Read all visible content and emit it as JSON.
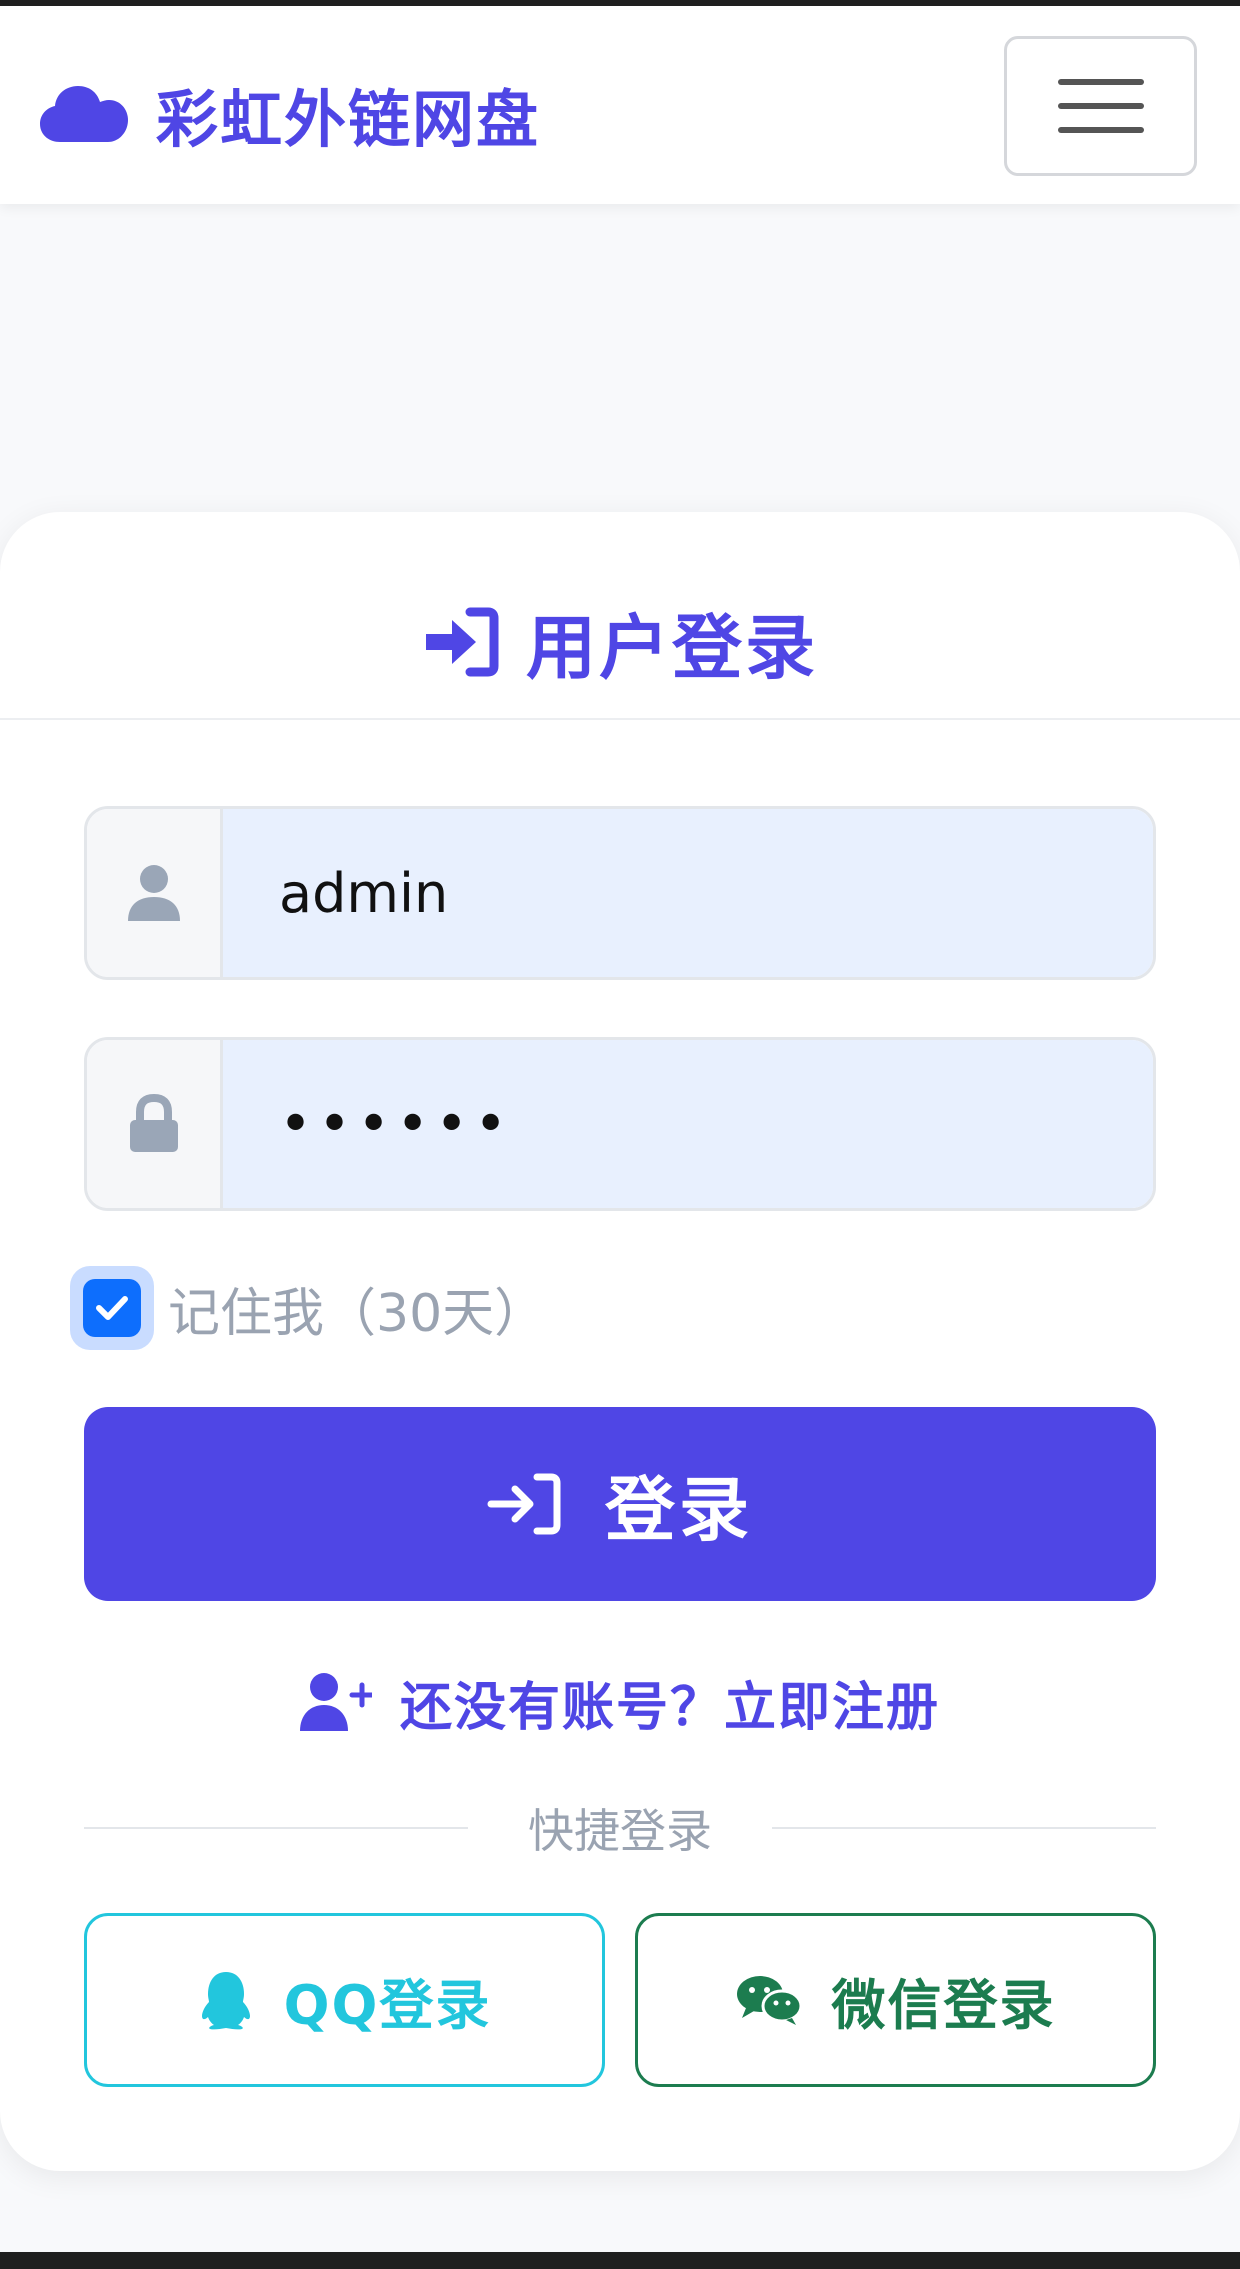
{
  "navbar": {
    "brand": "彩虹外链网盘",
    "brand_icon": "cloud-icon",
    "menu_icon": "hamburger-menu-icon"
  },
  "login": {
    "title": "用户登录",
    "title_icon": "sign-in-icon",
    "username_value": "admin",
    "username_icon": "user-icon",
    "password_value": "••••••",
    "password_icon": "lock-icon",
    "remember_label": "记住我（30天）",
    "remember_checked": true,
    "submit_label": "登录",
    "register_text": "还没有账号？立即注册",
    "register_icon": "user-plus-icon",
    "quick_login_label": "快捷登录",
    "qq_label": "QQ登录",
    "wechat_label": "微信登录"
  },
  "colors": {
    "primary": "#4f46e5",
    "qq": "#22c6dd",
    "wechat": "#1c7c4f",
    "checkbox": "#0d6efd",
    "input_fill": "#e8f0fe"
  }
}
